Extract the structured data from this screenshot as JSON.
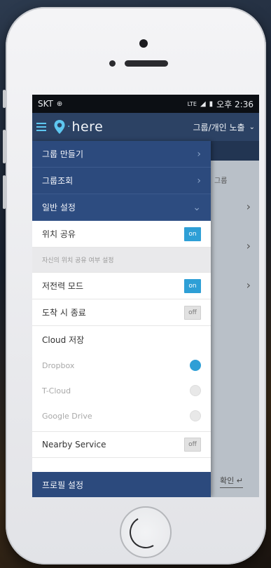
{
  "status": {
    "carrier": "SKT",
    "network": "LTE",
    "time": "오후 2:36"
  },
  "appbar": {
    "logo_text": "here",
    "group_select_label": "그룹/개인 노출"
  },
  "drawer": {
    "menu": [
      {
        "label": "그룹 만들기",
        "chevron": "›"
      },
      {
        "label": "그룹조회",
        "chevron": "›"
      },
      {
        "label": "일반 설정",
        "chevron": "⌄"
      }
    ],
    "settings": {
      "location_share": {
        "label": "위치 공유",
        "value": "on"
      },
      "location_share_desc": "자신의 위치 공유 여부 설정",
      "power_save": {
        "label": "저전력 모드",
        "value": "on"
      },
      "arrival_end": {
        "label": "도착 시 종료",
        "value": "off"
      },
      "cloud_title": "Cloud 저장",
      "cloud_options": [
        {
          "label": "Dropbox",
          "selected": true
        },
        {
          "label": "T-Cloud",
          "selected": false
        },
        {
          "label": "Google Drive",
          "selected": false
        }
      ],
      "nearby": {
        "label": "Nearby Service",
        "value": "off"
      }
    },
    "footer_label": "프로필 설정"
  },
  "background": {
    "header_label": "그룹",
    "ok_label": "확인 ↵"
  },
  "colors": {
    "primary": "#2c4a7d",
    "accent": "#2e9fd6",
    "appbar": "#2c4264"
  }
}
